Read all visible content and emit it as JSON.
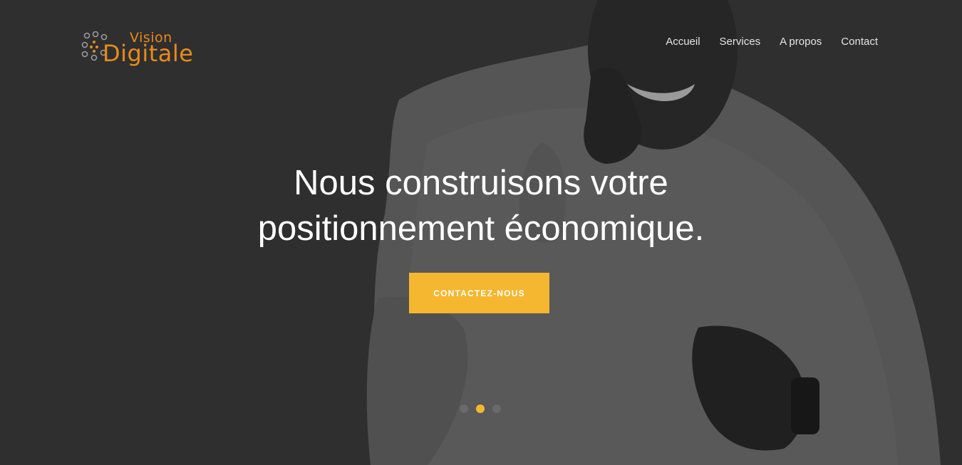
{
  "brand": {
    "name_line1": "Vision",
    "name_line2": "Digitale",
    "accent_color": "#e98b1a",
    "logo_icon": "dotted-circle-logo-icon"
  },
  "nav": {
    "items": [
      {
        "label": "Accueil"
      },
      {
        "label": "Services"
      },
      {
        "label": "A propos"
      },
      {
        "label": "Contact"
      }
    ]
  },
  "hero": {
    "title_line1": "Nous construisons votre",
    "title_line2": "positionnement économique.",
    "cta_label": "CONTACTEZ-NOUS",
    "cta_color": "#f5b730",
    "background_image": "man-in-shirt-pointing-photo"
  },
  "slider": {
    "slide_count": 3,
    "active_index": 1
  }
}
